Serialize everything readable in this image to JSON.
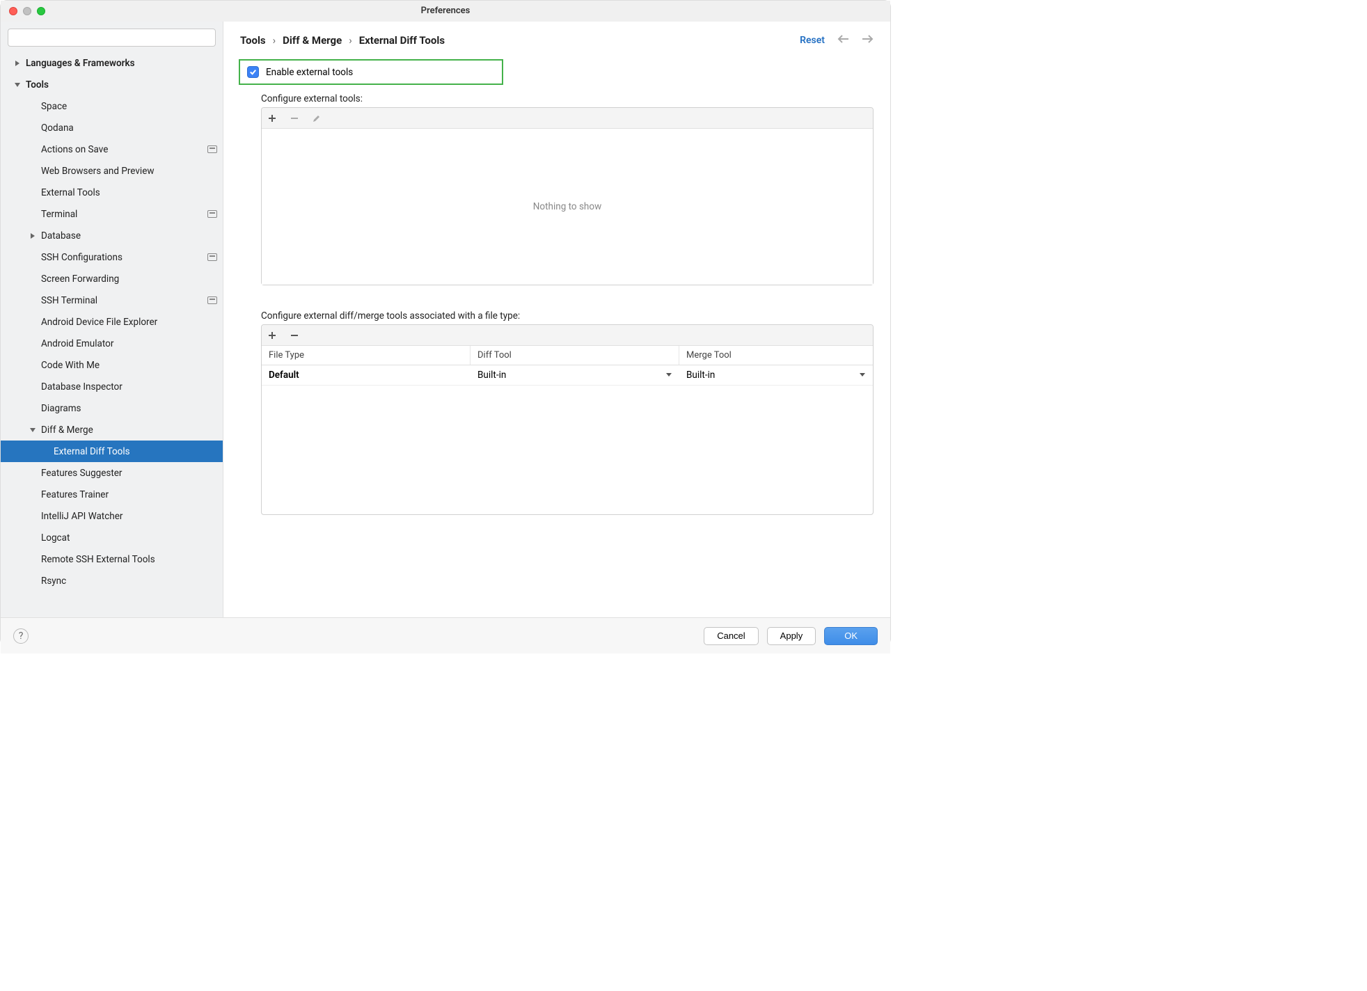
{
  "window": {
    "title": "Preferences"
  },
  "breadcrumb": {
    "item1": "Tools",
    "item2": "Diff & Merge",
    "item3": "External Diff Tools",
    "reset": "Reset"
  },
  "sidebar": {
    "languages": "Languages & Frameworks",
    "tools": "Tools",
    "items": [
      {
        "label": "Space"
      },
      {
        "label": "Qodana"
      },
      {
        "label": "Actions on Save",
        "badge": true
      },
      {
        "label": "Web Browsers and Preview"
      },
      {
        "label": "External Tools"
      },
      {
        "label": "Terminal",
        "badge": true
      },
      {
        "label": "Database",
        "expandable": true
      },
      {
        "label": "SSH Configurations",
        "badge": true
      },
      {
        "label": "Screen Forwarding"
      },
      {
        "label": "SSH Terminal",
        "badge": true
      },
      {
        "label": "Android Device File Explorer"
      },
      {
        "label": "Android Emulator"
      },
      {
        "label": "Code With Me"
      },
      {
        "label": "Database Inspector"
      },
      {
        "label": "Diagrams"
      }
    ],
    "diff_merge": "Diff & Merge",
    "diff_child": "External Diff Tools",
    "tail": [
      {
        "label": "Features Suggester"
      },
      {
        "label": "Features Trainer"
      },
      {
        "label": "IntelliJ API Watcher"
      },
      {
        "label": "Logcat"
      },
      {
        "label": "Remote SSH External Tools"
      },
      {
        "label": "Rsync"
      }
    ]
  },
  "main": {
    "enable_label": "Enable external tools",
    "configure_label": "Configure external tools:",
    "nothing": "Nothing to show",
    "configure_assoc_label": "Configure external diff/merge tools associated with a file type:",
    "columns": {
      "ft": "File Type",
      "dt": "Diff Tool",
      "mt": "Merge Tool"
    },
    "row": {
      "ft": "Default",
      "dt": "Built-in",
      "mt": "Built-in"
    }
  },
  "footer": {
    "cancel": "Cancel",
    "apply": "Apply",
    "ok": "OK"
  }
}
